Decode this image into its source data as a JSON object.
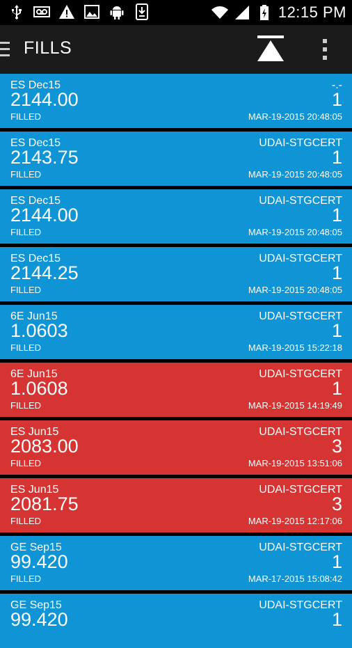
{
  "status_bar": {
    "time": "12:15 PM",
    "left_icons": [
      "usb-icon",
      "voicemail-icon",
      "warning-icon",
      "image-icon",
      "android-icon",
      "download-icon"
    ],
    "right_icons": [
      "wifi-icon",
      "signal-icon",
      "battery-charging-icon"
    ]
  },
  "app_bar": {
    "title": "FILLS",
    "icons": [
      "menu-icon",
      "scroll-to-top-icon",
      "more-vert-icon"
    ]
  },
  "colors": {
    "buy": "#0f95d6",
    "sell": "#d53433",
    "appbar": "#1b1b1b"
  },
  "fills": [
    {
      "symbol": "ES Dec15",
      "price": "2144.00",
      "status": "FILLED",
      "account": "-.-",
      "qty": "1",
      "time": "MAR-19-2015 20:48:05",
      "side": "buy"
    },
    {
      "symbol": "ES Dec15",
      "price": "2143.75",
      "status": "FILLED",
      "account": "UDAI-STGCERT",
      "qty": "1",
      "time": "MAR-19-2015 20:48:05",
      "side": "buy"
    },
    {
      "symbol": "ES Dec15",
      "price": "2144.00",
      "status": "FILLED",
      "account": "UDAI-STGCERT",
      "qty": "1",
      "time": "MAR-19-2015 20:48:05",
      "side": "buy"
    },
    {
      "symbol": "ES Dec15",
      "price": "2144.25",
      "status": "FILLED",
      "account": "UDAI-STGCERT",
      "qty": "1",
      "time": "MAR-19-2015 20:48:05",
      "side": "buy"
    },
    {
      "symbol": "6E Jun15",
      "price": "1.0603",
      "status": "FILLED",
      "account": "UDAI-STGCERT",
      "qty": "1",
      "time": "MAR-19-2015 15:22:18",
      "side": "buy"
    },
    {
      "symbol": "6E Jun15",
      "price": "1.0608",
      "status": "FILLED",
      "account": "UDAI-STGCERT",
      "qty": "1",
      "time": "MAR-19-2015 14:19:49",
      "side": "sell"
    },
    {
      "symbol": "ES Jun15",
      "price": "2083.00",
      "status": "FILLED",
      "account": "UDAI-STGCERT",
      "qty": "3",
      "time": "MAR-19-2015 13:51:06",
      "side": "sell"
    },
    {
      "symbol": "ES Jun15",
      "price": "2081.75",
      "status": "FILLED",
      "account": "UDAI-STGCERT",
      "qty": "3",
      "time": "MAR-19-2015 12:17:06",
      "side": "sell"
    },
    {
      "symbol": "GE Sep15",
      "price": "99.420",
      "status": "FILLED",
      "account": "UDAI-STGCERT",
      "qty": "1",
      "time": "MAR-17-2015 15:08:42",
      "side": "buy"
    },
    {
      "symbol": "GE Sep15",
      "price": "99.420",
      "status": "",
      "account": "UDAI-STGCERT",
      "qty": "1",
      "time": "",
      "side": "buy"
    }
  ]
}
